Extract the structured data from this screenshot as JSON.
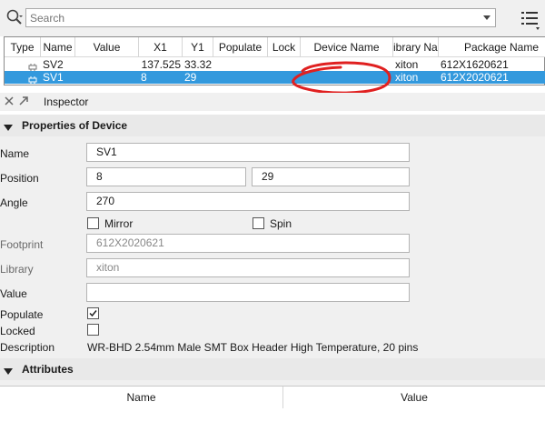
{
  "search": {
    "placeholder": "Search"
  },
  "table": {
    "columns": [
      "Type",
      "Name",
      "Value",
      "X1",
      "Y1",
      "Populate",
      "Lock",
      "Device Name",
      "ibrary Nar",
      "Package Name"
    ],
    "rows": [
      {
        "name": "SV2",
        "value": "",
        "x1": "137.525",
        "y1": "33.32",
        "populate": "",
        "lock": "",
        "device_name": "",
        "library": "xiton",
        "package": "612X1620621",
        "selected": false
      },
      {
        "name": "SV1",
        "value": "",
        "x1": "8",
        "y1": "29",
        "populate": "",
        "lock": "",
        "device_name": "",
        "library": "xiton",
        "package": "612X2020621",
        "selected": true
      }
    ]
  },
  "inspector": {
    "title": "Inspector",
    "properties_header": "Properties of Device",
    "labels": {
      "name": "Name",
      "position": "Position",
      "angle": "Angle",
      "mirror": "Mirror",
      "spin": "Spin",
      "footprint": "Footprint",
      "library": "Library",
      "value": "Value",
      "populate": "Populate",
      "locked": "Locked",
      "description": "Description"
    },
    "values": {
      "name": "SV1",
      "position_x": "8",
      "position_y": "29",
      "angle": "270",
      "footprint": "612X2020621",
      "library": "xiton",
      "value": "",
      "description": "WR-BHD 2.54mm Male SMT Box Header High Temperature, 20 pins"
    },
    "checkboxes": {
      "mirror": false,
      "spin": false,
      "populate": true,
      "locked": false
    },
    "attributes_header": "Attributes",
    "attributes_columns": [
      "Name",
      "Value"
    ]
  },
  "colors": {
    "selection": "#3399dd",
    "annotation": "#e02020",
    "panel": "#f0f0f0"
  },
  "icons": [
    "search-icon",
    "dropdown-arrow-icon",
    "list-menu-icon",
    "component-icon",
    "close-icon",
    "pop-out-icon",
    "collapse-triangle-icon",
    "checkmark-icon"
  ]
}
